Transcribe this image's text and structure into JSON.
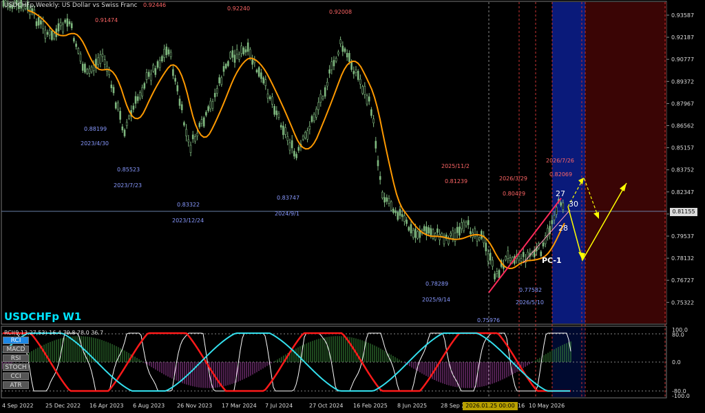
{
  "window_title": "USDCHFp,Weekly:  US Dollar vs Swiss Franc",
  "symbol_tf": "USDCHFp W1",
  "current_price": "0.81155",
  "crosshair_time": "2026.01.25 00:00",
  "indicator_buttons": [
    "RCI",
    "MACD",
    "RSI",
    "STOCH",
    "CCI",
    "ATR"
  ],
  "rci_header": "RCI(9,13,27,53) 16.4 79.8 78.0 36.7",
  "price_axis": [
    "0.93587",
    "0.92187",
    "0.90777",
    "0.89372",
    "0.87967",
    "0.86562",
    "0.85157",
    "0.83752",
    "0.82347",
    "0.80937",
    "0.79537",
    "0.78132",
    "0.76727",
    "0.75322"
  ],
  "osc_axis": [
    "100.0",
    "80.0",
    "0.0",
    "-80.0",
    "-100.0"
  ],
  "time_axis": [
    "4 Sep 2022",
    "25 Dec 2022",
    "16 Apr 2023",
    "6 Aug 2023",
    "26 Nov 2023",
    "17 Mar 2024",
    "7 Jul 2024",
    "27 Oct 2024",
    "16 Feb 2025",
    "8 Jun 2025",
    "28 Sep 2025",
    "16",
    "10 May 2026"
  ],
  "high_labels": [
    {
      "price": "0.92446",
      "date": ""
    },
    {
      "price": "0.91474",
      "date": ""
    },
    {
      "price": "0.92240",
      "date": ""
    },
    {
      "price": "0.92008",
      "date": ""
    },
    {
      "price": "0.81239",
      "date": "2025/11/2"
    },
    {
      "price": "0.80429",
      "date": "2026/3/29"
    },
    {
      "price": "0.82069",
      "date": "2026/7/26"
    }
  ],
  "low_labels": [
    {
      "price": "0.88199",
      "date": "2023/4/30"
    },
    {
      "price": "0.85523",
      "date": "2023/7/23"
    },
    {
      "price": "0.83322",
      "date": "2023/12/24"
    },
    {
      "price": "0.83747",
      "date": "2024/9/1"
    },
    {
      "price": "0.78289",
      "date": "2025/9/14"
    },
    {
      "price": "0.77582",
      "date": "2026/5/10"
    },
    {
      "price": "0.75976",
      "date": ""
    }
  ],
  "wave_labels": {
    "pc1": "PC-1",
    "w27": "27",
    "w28": "28",
    "w30": "30"
  },
  "colors": {
    "bg": "#000000",
    "candle": "#7fb87f",
    "ma": "#ff9900",
    "high_text": "#ff6666",
    "low_text": "#8899ff",
    "blue_zone": "#0a1a7a",
    "red_zone": "#3a0505",
    "rci_white": "#ffffff",
    "rci_red": "#ff1a1a",
    "rci_cyan": "#33e0ee",
    "macd_pos": "#3d8f3d",
    "macd_neg": "#a040a0",
    "projection": "#ffff00"
  }
}
